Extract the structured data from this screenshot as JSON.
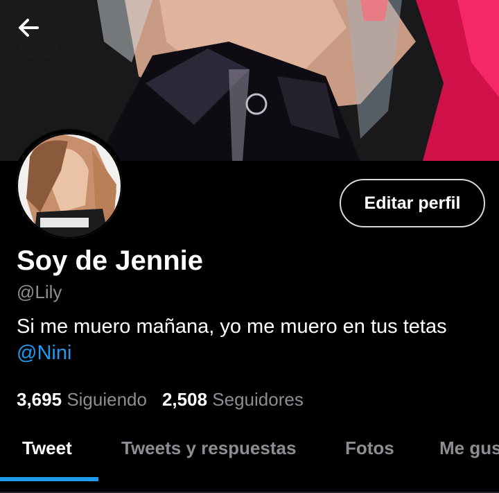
{
  "header": {
    "banner_image": "profile-banner-photo",
    "back_icon": "arrow-left-icon"
  },
  "profile": {
    "avatar_image": "profile-avatar-photo",
    "edit_label": "Editar perfil",
    "display_name": "Soy de Jennie",
    "handle": "@Lily",
    "bio_text": "Si me muero mañana, yo me muero en tus tetas ",
    "bio_mention": "@Nini",
    "following_count": "3,695",
    "following_label": "Siguiendo",
    "followers_count": "2,508",
    "followers_label": "Seguidores"
  },
  "tabs": [
    {
      "label": "Tweet",
      "active": true
    },
    {
      "label": "Tweets y respuestas",
      "active": false
    },
    {
      "label": "Fotos",
      "active": false
    },
    {
      "label": "Me gus",
      "active": false
    }
  ],
  "colors": {
    "background": "#000000",
    "accent": "#1d9bf0",
    "secondary_text": "#8b8f94",
    "button_border": "#d9d9d9"
  }
}
